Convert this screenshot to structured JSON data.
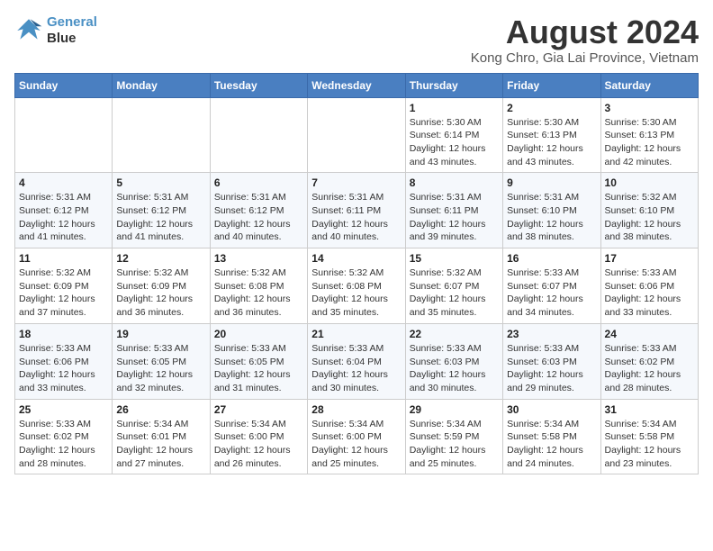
{
  "header": {
    "logo_line1": "General",
    "logo_line2": "Blue",
    "title": "August 2024",
    "subtitle": "Kong Chro, Gia Lai Province, Vietnam"
  },
  "weekdays": [
    "Sunday",
    "Monday",
    "Tuesday",
    "Wednesday",
    "Thursday",
    "Friday",
    "Saturday"
  ],
  "weeks": [
    [
      {
        "day": "",
        "info": ""
      },
      {
        "day": "",
        "info": ""
      },
      {
        "day": "",
        "info": ""
      },
      {
        "day": "",
        "info": ""
      },
      {
        "day": "1",
        "info": "Sunrise: 5:30 AM\nSunset: 6:14 PM\nDaylight: 12 hours\nand 43 minutes."
      },
      {
        "day": "2",
        "info": "Sunrise: 5:30 AM\nSunset: 6:13 PM\nDaylight: 12 hours\nand 43 minutes."
      },
      {
        "day": "3",
        "info": "Sunrise: 5:30 AM\nSunset: 6:13 PM\nDaylight: 12 hours\nand 42 minutes."
      }
    ],
    [
      {
        "day": "4",
        "info": "Sunrise: 5:31 AM\nSunset: 6:12 PM\nDaylight: 12 hours\nand 41 minutes."
      },
      {
        "day": "5",
        "info": "Sunrise: 5:31 AM\nSunset: 6:12 PM\nDaylight: 12 hours\nand 41 minutes."
      },
      {
        "day": "6",
        "info": "Sunrise: 5:31 AM\nSunset: 6:12 PM\nDaylight: 12 hours\nand 40 minutes."
      },
      {
        "day": "7",
        "info": "Sunrise: 5:31 AM\nSunset: 6:11 PM\nDaylight: 12 hours\nand 40 minutes."
      },
      {
        "day": "8",
        "info": "Sunrise: 5:31 AM\nSunset: 6:11 PM\nDaylight: 12 hours\nand 39 minutes."
      },
      {
        "day": "9",
        "info": "Sunrise: 5:31 AM\nSunset: 6:10 PM\nDaylight: 12 hours\nand 38 minutes."
      },
      {
        "day": "10",
        "info": "Sunrise: 5:32 AM\nSunset: 6:10 PM\nDaylight: 12 hours\nand 38 minutes."
      }
    ],
    [
      {
        "day": "11",
        "info": "Sunrise: 5:32 AM\nSunset: 6:09 PM\nDaylight: 12 hours\nand 37 minutes."
      },
      {
        "day": "12",
        "info": "Sunrise: 5:32 AM\nSunset: 6:09 PM\nDaylight: 12 hours\nand 36 minutes."
      },
      {
        "day": "13",
        "info": "Sunrise: 5:32 AM\nSunset: 6:08 PM\nDaylight: 12 hours\nand 36 minutes."
      },
      {
        "day": "14",
        "info": "Sunrise: 5:32 AM\nSunset: 6:08 PM\nDaylight: 12 hours\nand 35 minutes."
      },
      {
        "day": "15",
        "info": "Sunrise: 5:32 AM\nSunset: 6:07 PM\nDaylight: 12 hours\nand 35 minutes."
      },
      {
        "day": "16",
        "info": "Sunrise: 5:33 AM\nSunset: 6:07 PM\nDaylight: 12 hours\nand 34 minutes."
      },
      {
        "day": "17",
        "info": "Sunrise: 5:33 AM\nSunset: 6:06 PM\nDaylight: 12 hours\nand 33 minutes."
      }
    ],
    [
      {
        "day": "18",
        "info": "Sunrise: 5:33 AM\nSunset: 6:06 PM\nDaylight: 12 hours\nand 33 minutes."
      },
      {
        "day": "19",
        "info": "Sunrise: 5:33 AM\nSunset: 6:05 PM\nDaylight: 12 hours\nand 32 minutes."
      },
      {
        "day": "20",
        "info": "Sunrise: 5:33 AM\nSunset: 6:05 PM\nDaylight: 12 hours\nand 31 minutes."
      },
      {
        "day": "21",
        "info": "Sunrise: 5:33 AM\nSunset: 6:04 PM\nDaylight: 12 hours\nand 30 minutes."
      },
      {
        "day": "22",
        "info": "Sunrise: 5:33 AM\nSunset: 6:03 PM\nDaylight: 12 hours\nand 30 minutes."
      },
      {
        "day": "23",
        "info": "Sunrise: 5:33 AM\nSunset: 6:03 PM\nDaylight: 12 hours\nand 29 minutes."
      },
      {
        "day": "24",
        "info": "Sunrise: 5:33 AM\nSunset: 6:02 PM\nDaylight: 12 hours\nand 28 minutes."
      }
    ],
    [
      {
        "day": "25",
        "info": "Sunrise: 5:33 AM\nSunset: 6:02 PM\nDaylight: 12 hours\nand 28 minutes."
      },
      {
        "day": "26",
        "info": "Sunrise: 5:34 AM\nSunset: 6:01 PM\nDaylight: 12 hours\nand 27 minutes."
      },
      {
        "day": "27",
        "info": "Sunrise: 5:34 AM\nSunset: 6:00 PM\nDaylight: 12 hours\nand 26 minutes."
      },
      {
        "day": "28",
        "info": "Sunrise: 5:34 AM\nSunset: 6:00 PM\nDaylight: 12 hours\nand 25 minutes."
      },
      {
        "day": "29",
        "info": "Sunrise: 5:34 AM\nSunset: 5:59 PM\nDaylight: 12 hours\nand 25 minutes."
      },
      {
        "day": "30",
        "info": "Sunrise: 5:34 AM\nSunset: 5:58 PM\nDaylight: 12 hours\nand 24 minutes."
      },
      {
        "day": "31",
        "info": "Sunrise: 5:34 AM\nSunset: 5:58 PM\nDaylight: 12 hours\nand 23 minutes."
      }
    ]
  ]
}
